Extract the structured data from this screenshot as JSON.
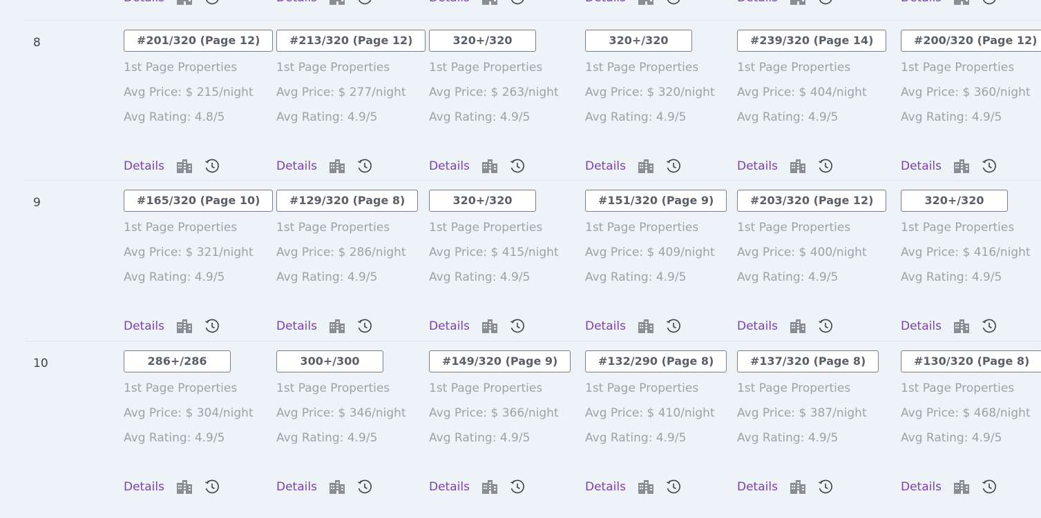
{
  "actions": {
    "details_label": "Details",
    "icons": [
      "buildings-icon",
      "history-clock-icon"
    ]
  },
  "columns_x": [
    179,
    400,
    621,
    847,
    1067,
    1304
  ],
  "top_partial_row": {
    "details_label": "Details"
  },
  "rows": [
    {
      "number": "8",
      "cells": [
        {
          "rank": "#201/320 (Page 12)",
          "label": "1st Page Properties",
          "price": "Avg Price: $ 215/night",
          "rating": "Avg Rating: 4.8/5"
        },
        {
          "rank": "#213/320 (Page 12)",
          "label": "1st Page Properties",
          "price": "Avg Price: $ 277/night",
          "rating": "Avg Rating: 4.9/5"
        },
        {
          "rank": "320+/320",
          "label": "1st Page Properties",
          "price": "Avg Price: $ 263/night",
          "rating": "Avg Rating: 4.9/5"
        },
        {
          "rank": "320+/320",
          "label": "1st Page Properties",
          "price": "Avg Price: $ 320/night",
          "rating": "Avg Rating: 4.9/5"
        },
        {
          "rank": "#239/320 (Page 14)",
          "label": "1st Page Properties",
          "price": "Avg Price: $ 404/night",
          "rating": "Avg Rating: 4.9/5"
        },
        {
          "rank": "#200/320 (Page 12)",
          "label": "1st Page Properties",
          "price": "Avg Price: $ 360/night",
          "rating": "Avg Rating: 4.9/5"
        }
      ]
    },
    {
      "number": "9",
      "cells": [
        {
          "rank": "#165/320 (Page 10)",
          "label": "1st Page Properties",
          "price": "Avg Price: $ 321/night",
          "rating": "Avg Rating: 4.9/5"
        },
        {
          "rank": "#129/320 (Page 8)",
          "label": "1st Page Properties",
          "price": "Avg Price: $ 286/night",
          "rating": "Avg Rating: 4.9/5"
        },
        {
          "rank": "320+/320",
          "label": "1st Page Properties",
          "price": "Avg Price: $ 415/night",
          "rating": "Avg Rating: 4.9/5"
        },
        {
          "rank": "#151/320 (Page 9)",
          "label": "1st Page Properties",
          "price": "Avg Price: $ 409/night",
          "rating": "Avg Rating: 4.9/5"
        },
        {
          "rank": "#203/320 (Page 12)",
          "label": "1st Page Properties",
          "price": "Avg Price: $ 400/night",
          "rating": "Avg Rating: 4.9/5"
        },
        {
          "rank": "320+/320",
          "label": "1st Page Properties",
          "price": "Avg Price: $ 416/night",
          "rating": "Avg Rating: 4.9/5"
        }
      ]
    },
    {
      "number": "10",
      "cells": [
        {
          "rank": "286+/286",
          "label": "1st Page Properties",
          "price": "Avg Price: $ 304/night",
          "rating": "Avg Rating: 4.9/5"
        },
        {
          "rank": "300+/300",
          "label": "1st Page Properties",
          "price": "Avg Price: $ 346/night",
          "rating": "Avg Rating: 4.9/5"
        },
        {
          "rank": "#149/320 (Page 9)",
          "label": "1st Page Properties",
          "price": "Avg Price: $ 366/night",
          "rating": "Avg Rating: 4.9/5"
        },
        {
          "rank": "#132/290 (Page 8)",
          "label": "1st Page Properties",
          "price": "Avg Price: $ 410/night",
          "rating": "Avg Rating: 4.9/5"
        },
        {
          "rank": "#137/320 (Page 8)",
          "label": "1st Page Properties",
          "price": "Avg Price: $ 387/night",
          "rating": "Avg Rating: 4.9/5"
        },
        {
          "rank": "#130/320 (Page 8)",
          "label": "1st Page Properties",
          "price": "Avg Price: $ 468/night",
          "rating": "Avg Rating: 4.9/5"
        }
      ]
    }
  ]
}
